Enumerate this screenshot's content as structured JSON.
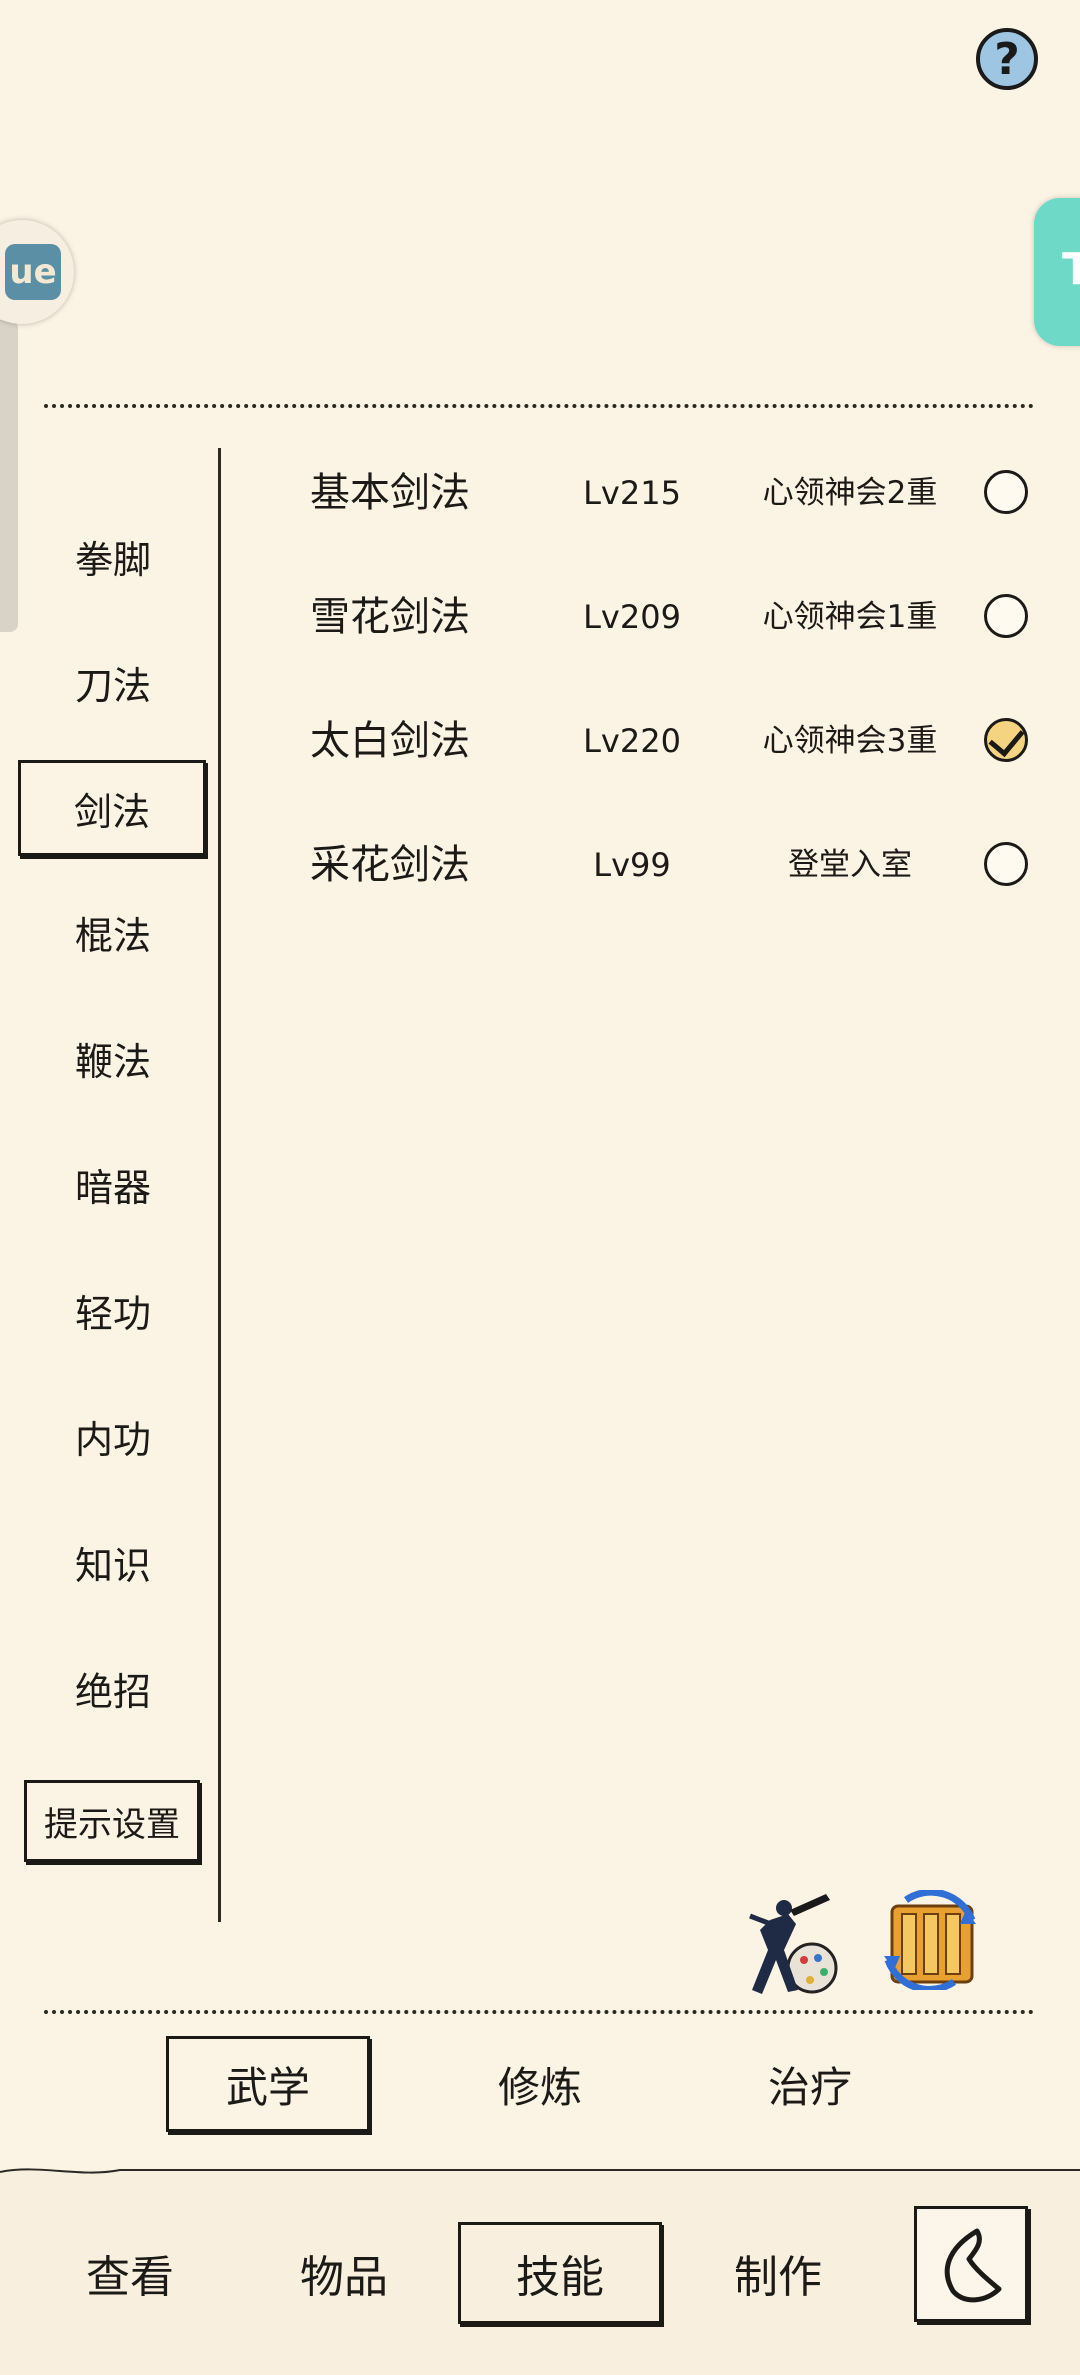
{
  "header": {
    "help_label": "?"
  },
  "left_float": {
    "label": "ue"
  },
  "right_float": {
    "label": "T"
  },
  "categories": [
    {
      "label": "拳脚",
      "selected": false
    },
    {
      "label": "刀法",
      "selected": false
    },
    {
      "label": "剑法",
      "selected": true
    },
    {
      "label": "棍法",
      "selected": false
    },
    {
      "label": "鞭法",
      "selected": false
    },
    {
      "label": "暗器",
      "selected": false
    },
    {
      "label": "轻功",
      "selected": false
    },
    {
      "label": "内功",
      "selected": false
    },
    {
      "label": "知识",
      "selected": false
    },
    {
      "label": "绝招",
      "selected": false
    }
  ],
  "hint_settings_label": "提示设置",
  "skills": [
    {
      "name": "基本剑法",
      "level": "Lv215",
      "stage": "心领神会2重",
      "checked": false
    },
    {
      "name": "雪花剑法",
      "level": "Lv209",
      "stage": "心领神会1重",
      "checked": false
    },
    {
      "name": "太白剑法",
      "level": "Lv220",
      "stage": "心领神会3重",
      "checked": true
    },
    {
      "name": "采花剑法",
      "level": "Lv99",
      "stage": "登堂入室",
      "checked": false
    }
  ],
  "action_icons": {
    "left": "martial-artist-icon",
    "right": "scroll-refresh-icon"
  },
  "tabs": [
    {
      "label": "武学",
      "active": true
    },
    {
      "label": "修炼",
      "active": false
    },
    {
      "label": "治疗",
      "active": false
    }
  ],
  "nav": [
    {
      "label": "查看",
      "active": false
    },
    {
      "label": "物品",
      "active": false
    },
    {
      "label": "技能",
      "active": true
    },
    {
      "label": "制作",
      "active": false
    }
  ],
  "colors": {
    "background": "#fbf3e4",
    "ink": "#1c1a17",
    "help": "#9ec6e2",
    "check": "#f4d480",
    "float_right": "#6fd9c8"
  }
}
